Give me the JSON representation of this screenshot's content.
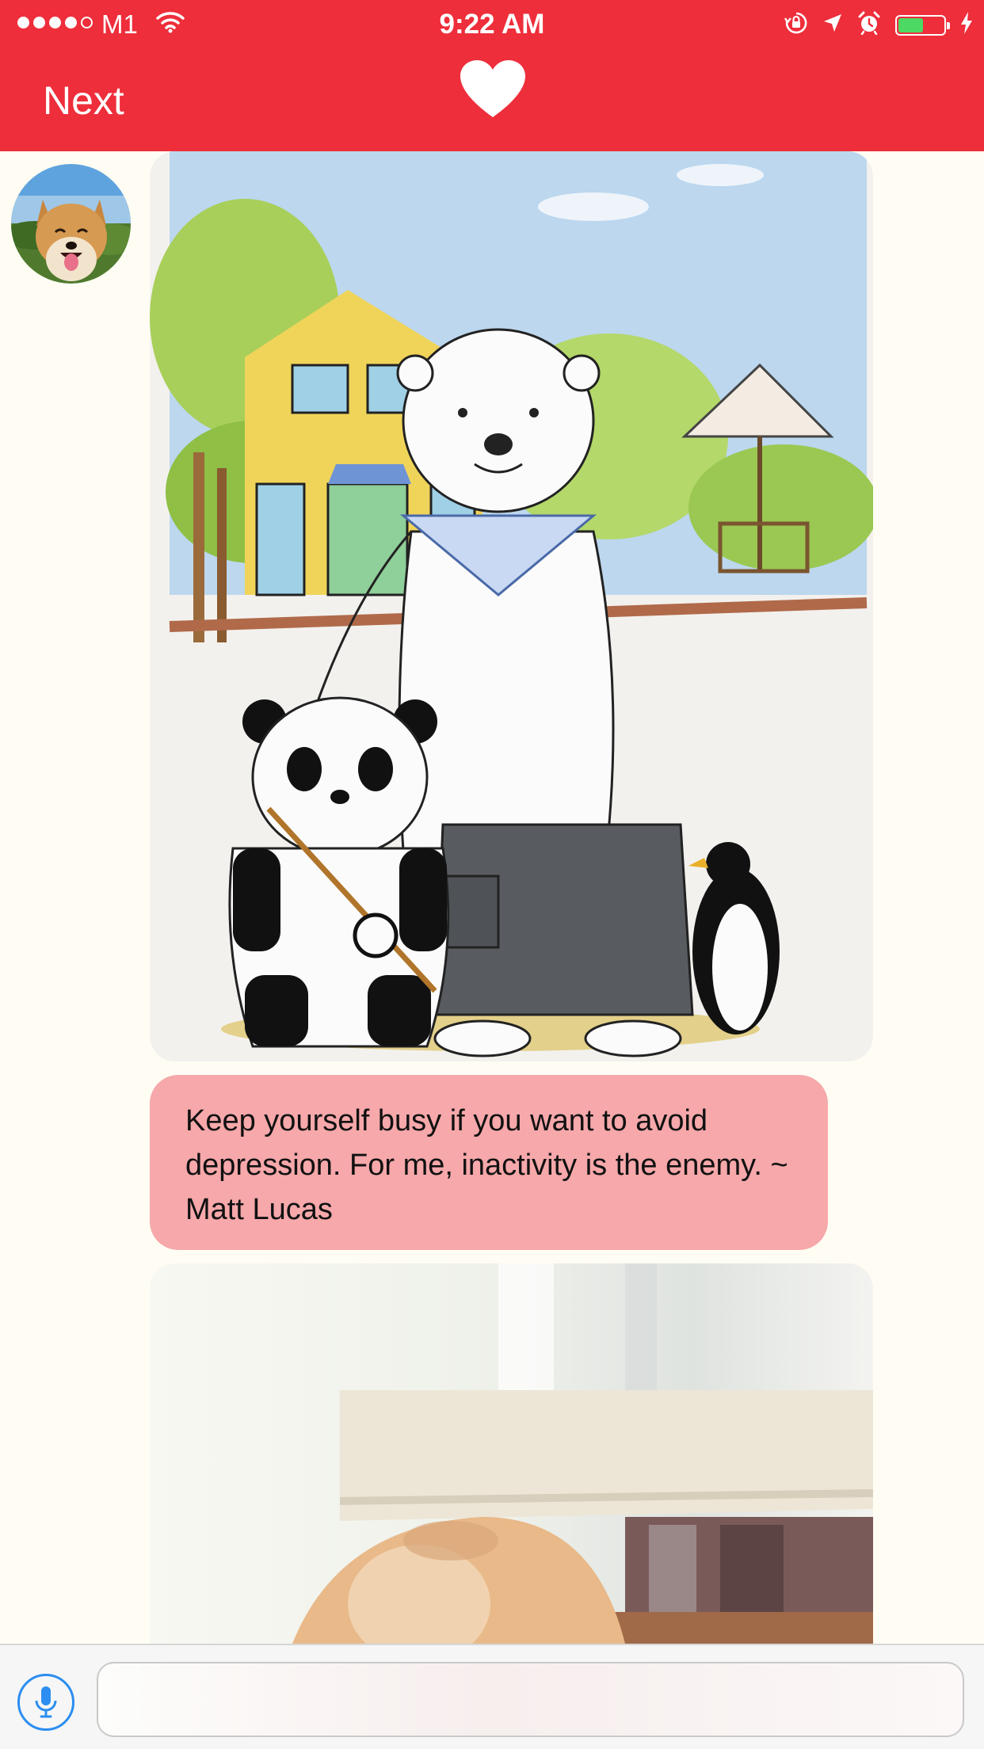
{
  "status_bar": {
    "carrier": "M1",
    "time": "9:22 AM",
    "signal_bars_filled": 4,
    "signal_bars_total": 5,
    "battery_level": 0.55,
    "icons": [
      "wifi-icon",
      "rotation-lock-icon",
      "location-icon",
      "alarm-icon",
      "battery-icon",
      "charging-bolt-icon"
    ]
  },
  "nav": {
    "next_label": "Next",
    "center_icon": "heart-icon"
  },
  "conversation": {
    "avatar": "dog-avatar",
    "messages": [
      {
        "kind": "image",
        "content": "illustration-bear-panda-penguin"
      },
      {
        "kind": "text",
        "text": "Keep yourself busy if you want to avoid depression. For me, inactivity is the enemy. ~ Matt Lucas"
      },
      {
        "kind": "image",
        "content": "photo-cat-under-curtain"
      }
    ]
  },
  "input_bar": {
    "mic_icon": "microphone-icon",
    "placeholder": ""
  },
  "colors": {
    "header_red": "#ee2e3b",
    "chat_background": "#fffdf3",
    "text_bubble_pink": "#f6a8aa",
    "mic_blue": "#2b8ef0",
    "battery_green": "#4cd964"
  }
}
